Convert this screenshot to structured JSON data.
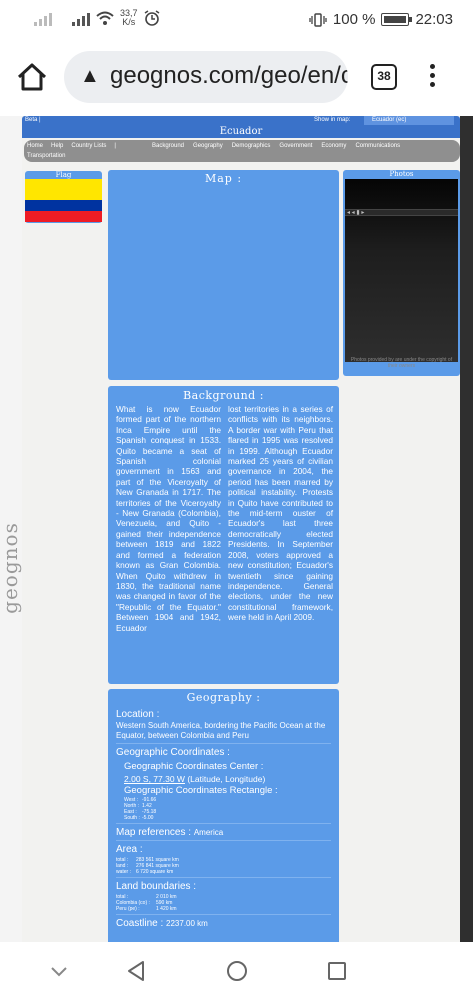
{
  "status": {
    "speed_value": "33,7",
    "speed_unit": "K/s",
    "battery": "100 %",
    "time": "22:03"
  },
  "browser": {
    "url": "geognos.com/geo/en/cc",
    "tab_count": "38"
  },
  "site": {
    "beta_label": "Beta",
    "show_in_map_label": "Show in map:",
    "country_select": "Ecuador (ec)",
    "country_title": "Ecuador",
    "logo_text": "geognos",
    "menu_left": [
      "Home",
      "Help",
      "Country Lists",
      "|"
    ],
    "menu_right": [
      "Background",
      "Geography",
      "Demographics",
      "Government",
      "Economy",
      "Communications"
    ],
    "menu_second_row": "Transportation"
  },
  "flag": {
    "heading": "Flag",
    "colors": [
      "#ffe600",
      "#0033a0",
      "#ee1c25"
    ]
  },
  "map": {
    "heading": "Map :"
  },
  "photos": {
    "heading": "Photos",
    "controls": "◂ ◂ ▮ ▸",
    "caption": "Photos provided by  are under the copyright of their owners"
  },
  "background": {
    "heading": "Background :",
    "col1": "What is now Ecuador formed part of the northern Inca Empire until the Spanish conquest in 1533. Quito became a seat of Spanish colonial government in 1563 and part of the Viceroyalty of New Granada in 1717. The territories of the Viceroyalty - New Granada (Colombia), Venezuela, and Quito - gained their independence between 1819 and 1822 and formed a federation known as Gran Colombia. When Quito withdrew in 1830, the traditional name was changed in favor of the \"Republic of the Equator.\" Between 1904 and 1942, Ecuador",
    "col2": "lost territories in a series of conflicts with its neighbors. A border war with Peru that flared in 1995 was resolved in 1999. Although Ecuador marked 25 years of civilian governance in 2004, the period has been marred by political instability. Protests in Quito have contributed to the mid-term ouster of Ecuador's last three democratically elected Presidents. In September 2008, voters approved a new constitution; Ecuador's twentieth since gaining independence. General elections, under the new constitutional framework, were held in April 2009."
  },
  "geography": {
    "heading": "Geography :",
    "location_label": "Location :",
    "location_text": "Western South America, bordering the Pacific Ocean at the Equator, between Colombia and Peru",
    "coords_label": "Geographic Coordinates :",
    "coords_center_label": "Geographic Coordinates Center :",
    "coords_center_value": "2.00 S, 77.30 W",
    "coords_center_suffix": " (Latitude, Longitude)",
    "coords_rect_label": "Geographic Coordinates Rectangle :",
    "rect": [
      {
        "k": "West :",
        "v": "-91.66"
      },
      {
        "k": "North :",
        "v": "1.42"
      },
      {
        "k": "East :",
        "v": "-75.18"
      },
      {
        "k": "South :",
        "v": "-5.00"
      }
    ],
    "mapref_label": "Map references :",
    "mapref_value": "America",
    "area_label": "Area :",
    "area": [
      {
        "k": "total :",
        "v": "283 561  square km"
      },
      {
        "k": "land :",
        "v": "276 841  square km"
      },
      {
        "k": "water :",
        "v": "6 720  square km"
      }
    ],
    "land_label": "Land boundaries :",
    "land": [
      {
        "k": "total :",
        "v": "2 010  km"
      },
      {
        "k": "Colombia (co) :",
        "v": "590  km"
      },
      {
        "k": "Peru (pe) :",
        "v": "1 420  km"
      }
    ],
    "coast_label": "Coastline :",
    "coast_value": "2237.00 km"
  }
}
